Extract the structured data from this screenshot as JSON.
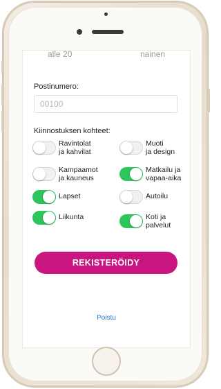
{
  "profile_row": {
    "age": "alle 20",
    "gender": "nainen"
  },
  "postal": {
    "label": "Postinumero:",
    "placeholder": "00100"
  },
  "interests": {
    "title": "Kiinnostuksen kohteet:",
    "items": [
      {
        "line1": "Ravintolat",
        "line2": "ja kahvilat",
        "on": false
      },
      {
        "line1": "Muoti",
        "line2": "ja design",
        "on": false
      },
      {
        "line1": "Kampaamot",
        "line2": "ja kauneus",
        "on": false
      },
      {
        "line1": "Matkailu ja",
        "line2": "vapaa-aika",
        "on": true
      },
      {
        "line1": "Lapset",
        "line2": "",
        "on": true
      },
      {
        "line1": "Autoilu",
        "line2": "",
        "on": false
      },
      {
        "line1": "Liikunta",
        "line2": "",
        "on": true
      },
      {
        "line1": "Koti ja",
        "line2": "palvelut",
        "on": true
      }
    ]
  },
  "actions": {
    "register_label": "REKISTERÖIDY",
    "logout_label": "Poistu"
  },
  "colors": {
    "accent": "#c8157f",
    "toggle_on": "#2ec65a",
    "link": "#2a7bd6"
  }
}
